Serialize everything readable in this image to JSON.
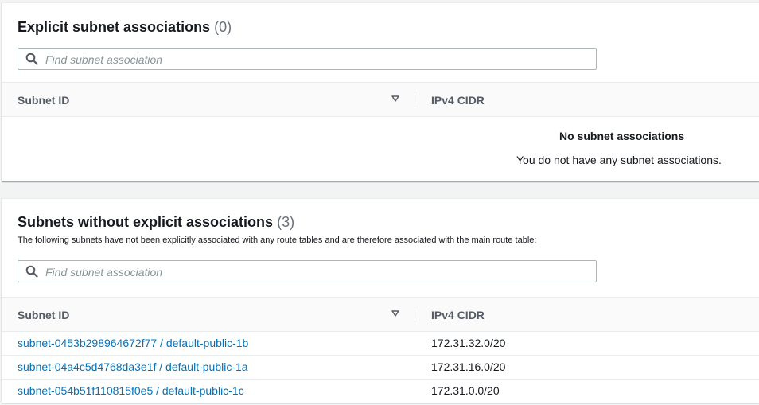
{
  "explicit_section": {
    "title": "Explicit subnet associations",
    "count": "(0)",
    "search_placeholder": "Find subnet association",
    "columns": {
      "subnet_id": "Subnet ID",
      "ipv4_cidr": "IPv4 CIDR"
    },
    "empty_title": "No subnet associations",
    "empty_message": "You do not have any subnet associations."
  },
  "implicit_section": {
    "title": "Subnets without explicit associations",
    "count": "(3)",
    "description": "The following subnets have not been explicitly associated with any route tables and are therefore associated with the main route table:",
    "search_placeholder": "Find subnet association",
    "columns": {
      "subnet_id": "Subnet ID",
      "ipv4_cidr": "IPv4 CIDR"
    },
    "rows": [
      {
        "subnet": "subnet-0453b298964672f77 / default-public-1b",
        "cidr": "172.31.32.0/20"
      },
      {
        "subnet": "subnet-04a4c5d4768da3e1f / default-public-1a",
        "cidr": "172.31.16.0/20"
      },
      {
        "subnet": "subnet-054b51f110815f0e5 / default-public-1c",
        "cidr": "172.31.0.0/20"
      }
    ]
  },
  "icons": {
    "search": "search-icon",
    "sort": "sort-down-icon"
  },
  "colors": {
    "link": "#0073bb",
    "page_bg": "#f2f3f3",
    "header_bg": "#fafafa"
  }
}
